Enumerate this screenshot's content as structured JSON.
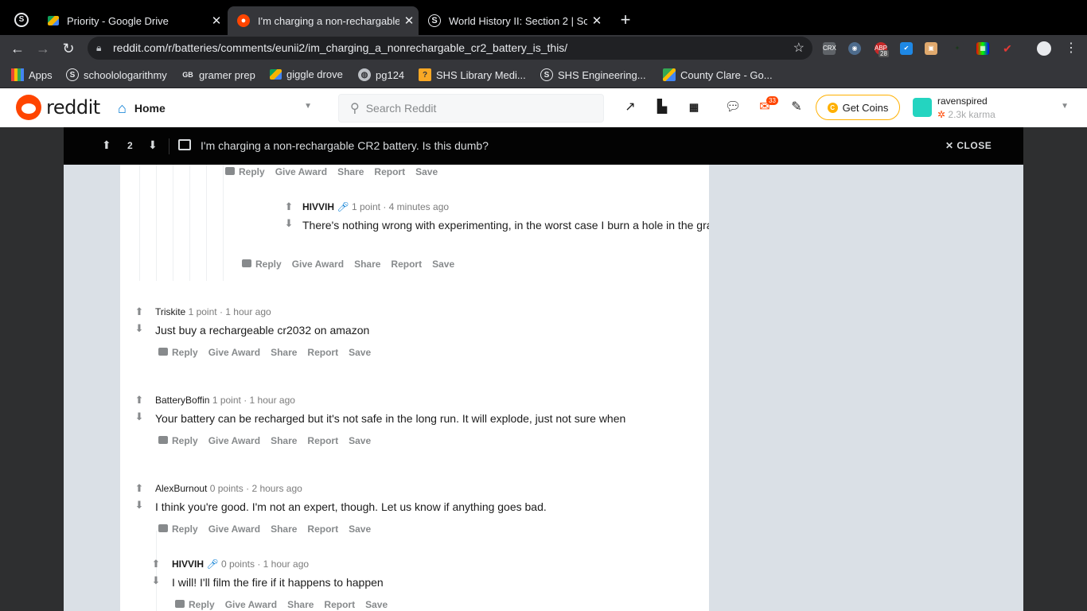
{
  "browser": {
    "tabs": [
      {
        "title": "Priority - Google Drive",
        "icon": "google-drive-icon",
        "active": false
      },
      {
        "title": "I'm charging a non-rechargable",
        "icon": "reddit-icon",
        "active": true
      },
      {
        "title": "World History II: Section 2 | Sc",
        "icon": "schoology-icon",
        "active": false
      }
    ],
    "url": "reddit.com/r/batteries/comments/eunii2/im_charging_a_nonrechargable_cr2_battery_is_this/",
    "ext_badge": "28",
    "bookmarks": [
      {
        "label": "Apps",
        "icon": "apps-grid-icon"
      },
      {
        "label": "schoolologarithmy",
        "icon": "schoology-icon"
      },
      {
        "label": "gramer prep",
        "icon": "gb-icon"
      },
      {
        "label": "giggle drove",
        "icon": "google-drive-icon"
      },
      {
        "label": "pg124",
        "icon": "globe-icon"
      },
      {
        "label": "SHS Library Medi...",
        "icon": "library-icon"
      },
      {
        "label": "SHS Engineering...",
        "icon": "schoology-icon"
      },
      {
        "label": "County Clare - Go...",
        "icon": "maps-icon"
      }
    ]
  },
  "reddit": {
    "logo_text": "reddit",
    "home_label": "Home",
    "search_placeholder": "Search Reddit",
    "mail_badge": "33",
    "coins_label": "Get Coins",
    "username": "ravenspired",
    "karma": "2.3k karma"
  },
  "post": {
    "score": "2",
    "title": "I'm charging a non-rechargable CR2 battery. Is this dumb?",
    "close_label": "CLOSE"
  },
  "actions": {
    "reply": "Reply",
    "give_award": "Give Award",
    "share": "Share",
    "report": "Report",
    "save": "Save"
  },
  "comments": [
    {
      "author": "HIVVIH",
      "points": "1 point",
      "sep": "·",
      "time": "4 minutes ago",
      "text": "There's nothing wrong with experimenting, in the worst case I burn a hole in the grass",
      "badge": true
    },
    {
      "author": "Triskite",
      "points": "1 point",
      "sep": "·",
      "time": "1 hour ago",
      "text": "Just buy a rechargeable cr2032 on amazon",
      "badge": false
    },
    {
      "author": "BatteryBoffin",
      "points": "1 point",
      "sep": "·",
      "time": "1 hour ago",
      "text": "Your battery can be recharged but it's not safe in the long run. It will explode, just not sure when",
      "badge": false
    },
    {
      "author": "AlexBurnout",
      "points": "0 points",
      "sep": "·",
      "time": "2 hours ago",
      "text": "I think you're good. I'm not an expert, though. Let us know if anything goes bad.",
      "badge": false
    },
    {
      "author": "HIVVIH",
      "points": "0 points",
      "sep": "·",
      "time": "1 hour ago",
      "text": "I will! I'll film the fire if it happens to happen",
      "badge": true
    }
  ],
  "colors": {
    "reddit_orange": "#ff4500",
    "link_blue": "#0079d3",
    "coin_gold": "#ffb000",
    "overlay_bg": "#dae0e6"
  }
}
